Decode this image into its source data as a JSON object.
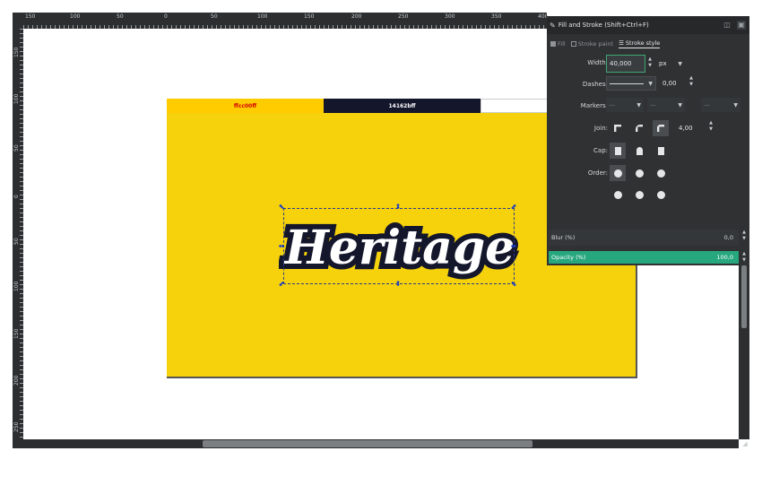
{
  "ruler": {
    "top_labels": [
      "150",
      "100",
      "50",
      "0",
      "50",
      "100",
      "150",
      "200",
      "250",
      "300",
      "350",
      "400"
    ],
    "left_labels": [
      "150",
      "100",
      "50",
      "0",
      "50",
      "100",
      "150",
      "200",
      "250"
    ]
  },
  "canvas": {
    "swatches": [
      {
        "label": "ffcc00ff",
        "color": "#ffcc00"
      },
      {
        "label": "14162bff",
        "color": "#14162b"
      },
      {
        "label": "",
        "color": "#ffffff"
      }
    ],
    "artboard_color": "#f5d20b",
    "logo_text": "Heritage",
    "logo_fill": "#ffffff",
    "logo_stroke": "#14162b"
  },
  "dialog": {
    "title": "Fill and Stroke (Shift+Ctrl+F)",
    "tabs": {
      "fill": "Fill",
      "stroke_paint": "Stroke paint",
      "stroke_style": "Stroke style"
    },
    "width_label": "Width:",
    "width_value": "40,000",
    "width_unit": "px",
    "dashes_label": "Dashes:",
    "dashes_offset": "0,00",
    "markers_label": "Markers:",
    "markers": [
      "—",
      "—",
      "—"
    ],
    "join_label": "Join:",
    "miter_limit": "4,00",
    "cap_label": "Cap:",
    "order_label": "Order:",
    "blur_label": "Blur (%)",
    "blur_value": "0,0",
    "opacity_label": "Opacity (%)",
    "opacity_value": "100,0",
    "accent": "#27a77d"
  }
}
